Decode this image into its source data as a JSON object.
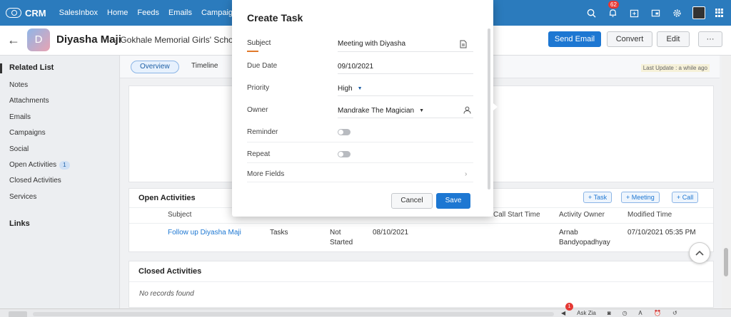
{
  "topnav": {
    "app_name": "CRM",
    "links": [
      "SalesInbox",
      "Home",
      "Feeds",
      "Emails",
      "Campaigns"
    ],
    "notification_count": "62"
  },
  "record": {
    "avatar_letter": "D",
    "name": "Diyasha Maji",
    "org": "- Gokhale Memorial Girls' School",
    "buttons": {
      "send_email": "Send Email",
      "convert": "Convert",
      "edit": "Edit",
      "more": "···"
    }
  },
  "sidebar": {
    "title": "Related List",
    "items": [
      "Notes",
      "Attachments",
      "Emails",
      "Campaigns",
      "Social",
      "Open Activities",
      "Closed Activities",
      "Services"
    ],
    "open_activities_count": "1",
    "links_title": "Links"
  },
  "tabs": {
    "overview": "Overview",
    "timeline": "Timeline"
  },
  "last_update": "Last Update : a while ago",
  "open_activities": {
    "title": "Open Activities",
    "buttons": [
      "+ Task",
      "+ Meeting",
      "+ Call"
    ],
    "headers": {
      "subject": "Subject",
      "call_start": "Call Start Time",
      "owner": "Activity Owner",
      "modified": "Modified Time"
    },
    "row": {
      "subject": "Follow up Diyasha Maji",
      "type": "Tasks",
      "status": "Not Started",
      "date": "08/10/2021",
      "owner": "Arnab Bandyopadhyay",
      "modified": "07/10/2021 05:35 PM"
    }
  },
  "closed_activities": {
    "title": "Closed Activities",
    "empty": "No records found"
  },
  "bottombar": {
    "ask_zia": "Ask Zia",
    "badge": "1"
  },
  "modal": {
    "title": "Create Task",
    "fields": {
      "subject_label": "Subject",
      "subject_value": "Meeting with Diyasha",
      "due_label": "Due Date",
      "due_value": "09/10/2021",
      "priority_label": "Priority",
      "priority_value": "High",
      "owner_label": "Owner",
      "owner_value": "Mandrake The Magician",
      "reminder_label": "Reminder",
      "repeat_label": "Repeat",
      "more_label": "More Fields"
    },
    "cancel": "Cancel",
    "save": "Save"
  }
}
